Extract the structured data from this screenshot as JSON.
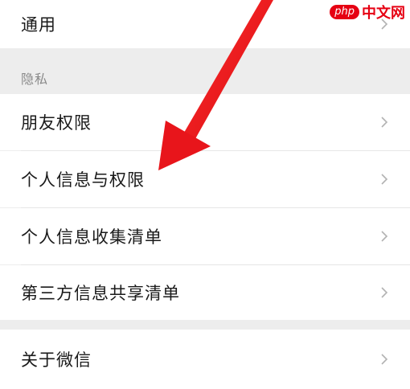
{
  "watermark": {
    "logo_text": "php",
    "site_text": "中文网"
  },
  "settings": {
    "general_label": "通用",
    "privacy_header": "隐私",
    "friend_permissions_label": "朋友权限",
    "personal_info_permissions_label": "个人信息与权限",
    "personal_info_collection_label": "个人信息收集清单",
    "third_party_sharing_label": "第三方信息共享清单",
    "about_wechat_label": "关于微信"
  },
  "colors": {
    "background": "#ededed",
    "row_background": "#ffffff",
    "annotation_arrow": "#e8151b",
    "watermark_red": "#e60012"
  },
  "icons": {
    "chevron": "chevron-right-icon",
    "annotation": "red-arrow-annotation"
  }
}
